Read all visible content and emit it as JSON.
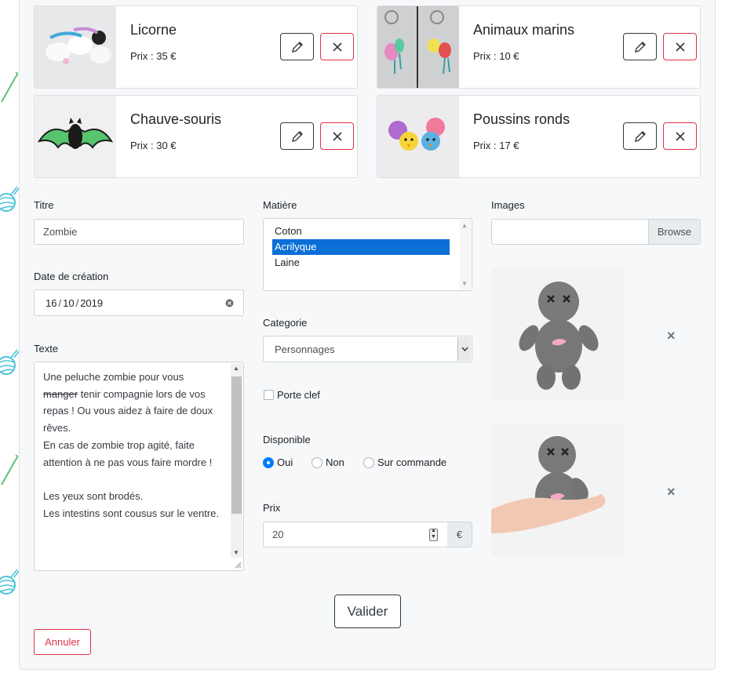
{
  "products": [
    {
      "name": "Licorne",
      "price": "Prix : 35 €"
    },
    {
      "name": "Animaux marins",
      "price": "Prix : 10 €"
    },
    {
      "name": "Chauve-souris",
      "price": "Prix : 30 €"
    },
    {
      "name": "Poussins ronds",
      "price": "Prix : 17 €"
    }
  ],
  "form": {
    "titre": {
      "label": "Titre",
      "value": "Zombie"
    },
    "date": {
      "label": "Date de création",
      "day": "16",
      "month": "10",
      "year": "2019",
      "sep": "/"
    },
    "texte": {
      "label": "Texte",
      "line1": "Une peluche zombie pour vous",
      "strike": "manger",
      "line2_rest": " tenir compagnie lors de vos repas ! Ou vous aidez à faire de doux rêves.",
      "line3": "En cas de zombie trop agité, faite attention à ne pas vous faire mordre !",
      "line4": "Les yeux sont brodés.",
      "line5": "Les intestins sont cousus sur le ventre."
    },
    "matiere": {
      "label": "Matière",
      "options": [
        "Coton",
        "Acrilyque",
        "Laine"
      ],
      "selected": "Acrilyque"
    },
    "categorie": {
      "label": "Categorie",
      "value": "Personnages"
    },
    "porte_clef": {
      "label": "Porte clef",
      "checked": false
    },
    "disponible": {
      "label": "Disponible",
      "options": [
        "Oui",
        "Non",
        "Sur commande"
      ],
      "selected": "Oui"
    },
    "prix": {
      "label": "Prix",
      "value": "20",
      "unit": "€"
    },
    "images": {
      "label": "Images",
      "browse": "Browse",
      "remove": "×"
    }
  },
  "actions": {
    "valider": "Valider",
    "annuler": "Annuler"
  },
  "icons": {
    "edit": "pencil-icon",
    "delete": "close-icon"
  },
  "colors": {
    "danger": "#dc3545",
    "primary": "#007bff",
    "selection": "#0a6fd6",
    "deco": "#4cc3d9"
  }
}
